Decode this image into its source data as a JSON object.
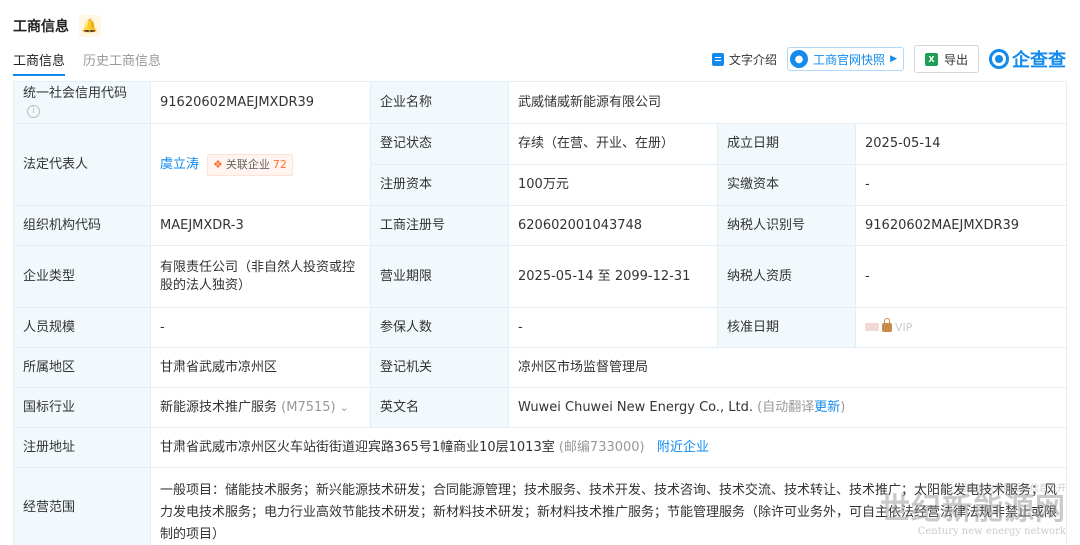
{
  "header": {
    "title": "工商信息",
    "tabs": [
      {
        "label": "工商信息",
        "active": true
      },
      {
        "label": "历史工商信息",
        "active": false
      }
    ],
    "actions": {
      "text_intro": "文字介绍",
      "official_snapshot": "工商官网快照",
      "export": "导出",
      "brand": "企查查"
    }
  },
  "rows": {
    "credit_code": {
      "label": "统一社会信用代码",
      "value": "91620602MAEJMXDR39"
    },
    "company_name": {
      "label": "企业名称",
      "value": "武威储威新能源有限公司"
    },
    "legal_rep": {
      "label": "法定代表人",
      "name": "虞立涛",
      "related_label": "关联企业",
      "related_count": "72"
    },
    "reg_status": {
      "label": "登记状态",
      "value": "存续（在营、开业、在册）"
    },
    "established": {
      "label": "成立日期",
      "value": "2025-05-14"
    },
    "reg_capital": {
      "label": "注册资本",
      "value": "100万元"
    },
    "paid_capital": {
      "label": "实缴资本",
      "value": "-"
    },
    "org_code": {
      "label": "组织机构代码",
      "value": "MAEJMXDR-3"
    },
    "reg_number": {
      "label": "工商注册号",
      "value": "620602001043748"
    },
    "taxpayer_id": {
      "label": "纳税人识别号",
      "value": "91620602MAEJMXDR39"
    },
    "company_type": {
      "label": "企业类型",
      "value": "有限责任公司（非自然人投资或控股的法人独资）"
    },
    "business_term": {
      "label": "营业期限",
      "value": "2025-05-14 至 2099-12-31"
    },
    "taxpayer_qual": {
      "label": "纳税人资质",
      "value": "-"
    },
    "staff_size": {
      "label": "人员规模",
      "value": "-"
    },
    "insured": {
      "label": "参保人数",
      "value": "-"
    },
    "approval_date": {
      "label": "核准日期",
      "vip_text": "VIP"
    },
    "region": {
      "label": "所属地区",
      "value": "甘肃省武威市凉州区"
    },
    "reg_authority": {
      "label": "登记机关",
      "value": "凉州区市场监督管理局"
    },
    "industry": {
      "label": "国标行业",
      "value": "新能源技术推广服务",
      "code": "(M7515)"
    },
    "english_name": {
      "label": "英文名",
      "value": "Wuwei Chuwei New Energy Co., Ltd.",
      "auto_note": "(自动翻译",
      "update_link": "更新",
      "close_paren": ")"
    },
    "address": {
      "label": "注册地址",
      "value": "甘肃省武威市凉州区火车站街街道迎宾路365号1幢商业10层1013室",
      "postcode": "(邮编733000)",
      "nearby_link": "附近企业"
    },
    "scope": {
      "label": "经营范围",
      "value": "一般项目：储能技术服务；新兴能源技术研发；合同能源管理；技术服务、技术开发、技术咨询、技术交流、技术转让、技术推广；太阳能发电技术服务；风力发电技术服务；电力行业高效节能技术研发；新材料技术研发；新材料技术推广服务；节能管理服务（除许可业务外，可自主依法经营法律法规非禁止或限制的项目）"
    }
  },
  "watermark": {
    "small": "国家发改委能源局信息公开",
    "big": "世纪新能源网",
    "en": "Century new energy network"
  }
}
